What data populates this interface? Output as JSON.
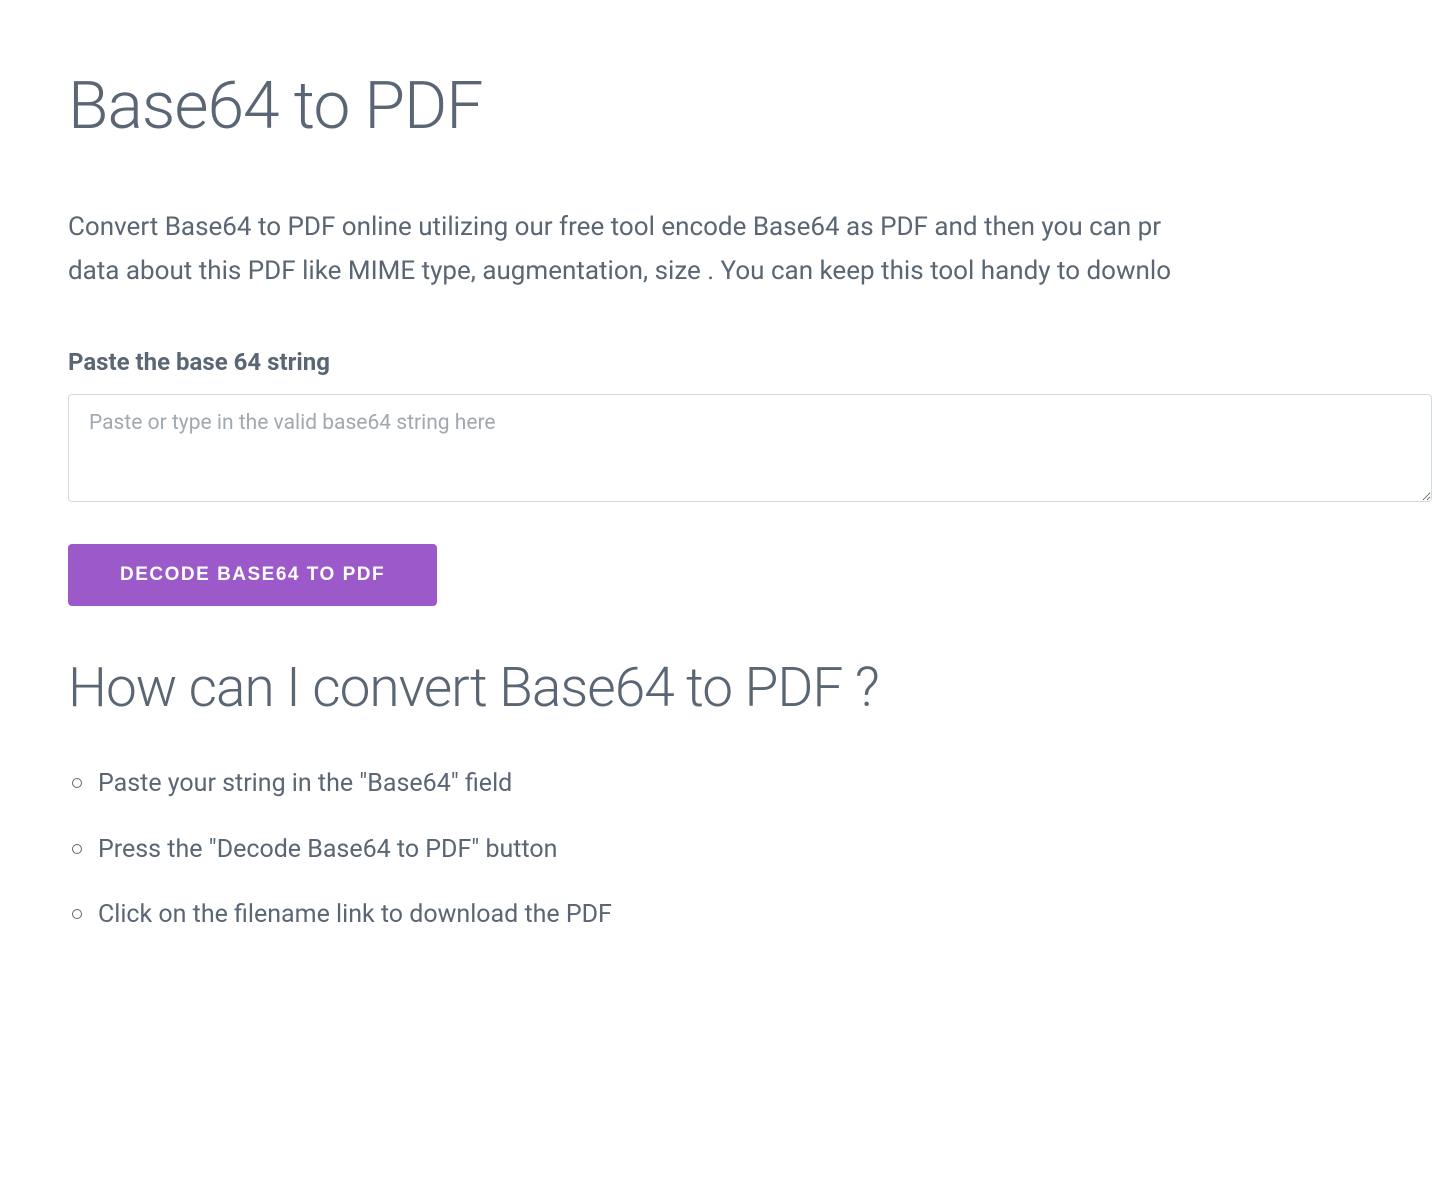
{
  "title": "Base64 to PDF",
  "description_line1": "Convert Base64 to PDF online utilizing our free tool encode Base64 as PDF and then you can pr",
  "description_line2": "data about this PDF like MIME type, augmentation, size . You can keep this tool handy to downlo",
  "input": {
    "label": "Paste the base 64 string",
    "placeholder": "Paste or type in the valid base64 string here"
  },
  "button": {
    "decode_label": "DECODE BASE64 TO PDF"
  },
  "howto": {
    "heading": "How can I convert Base64 to PDF ?",
    "steps": [
      "Paste your string in the \"Base64\" field",
      "Press the \"Decode Base64 to PDF\" button",
      "Click on the filename link to download the PDF"
    ]
  }
}
